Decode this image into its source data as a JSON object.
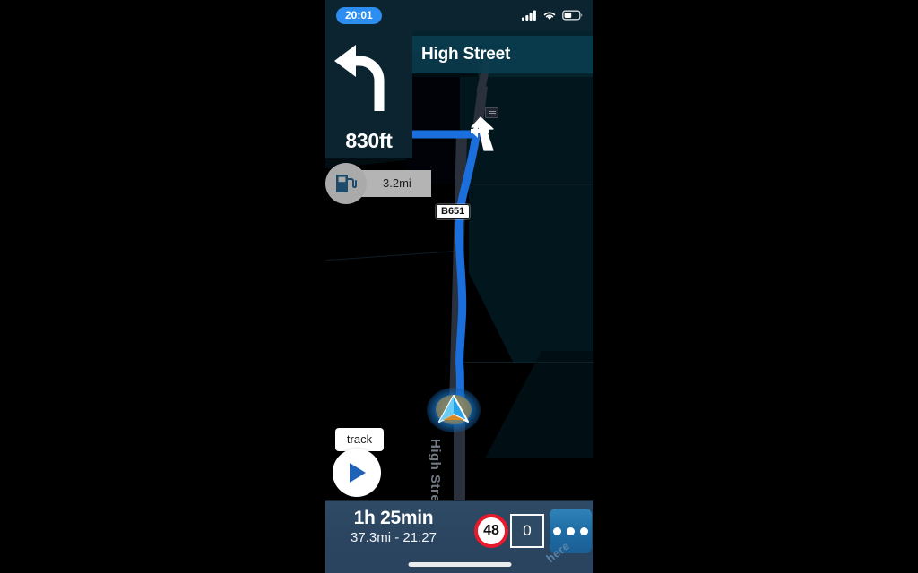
{
  "status_bar": {
    "clock": "20:01",
    "icons": [
      "signal-icon",
      "wifi-icon",
      "battery-icon"
    ]
  },
  "maneuver": {
    "icon": "turn-left-arrow-icon",
    "distance": "830ft",
    "street_name": "High Street"
  },
  "poi_chip": {
    "icon": "fuel-pump-icon",
    "distance": "3.2mi"
  },
  "map": {
    "road_shield": "B651",
    "street_label": "High Street",
    "position_marker": "vehicle-position-icon",
    "bridge_marker": "bridge-icon",
    "route_color": "#1a6fdd",
    "background_color": "#000000",
    "attribution": "here"
  },
  "track_control": {
    "tooltip": "track",
    "icon": "play-triangle-icon"
  },
  "bottom_bar": {
    "eta_duration": "1h 25min",
    "eta_details": "37.3mi - 21:27",
    "speed_limit": "48",
    "current_speed": "0",
    "menu_icon": "overflow-menu-icon",
    "speed_limit_color": "#e8192c",
    "menu_color": "#1e6ba3"
  }
}
